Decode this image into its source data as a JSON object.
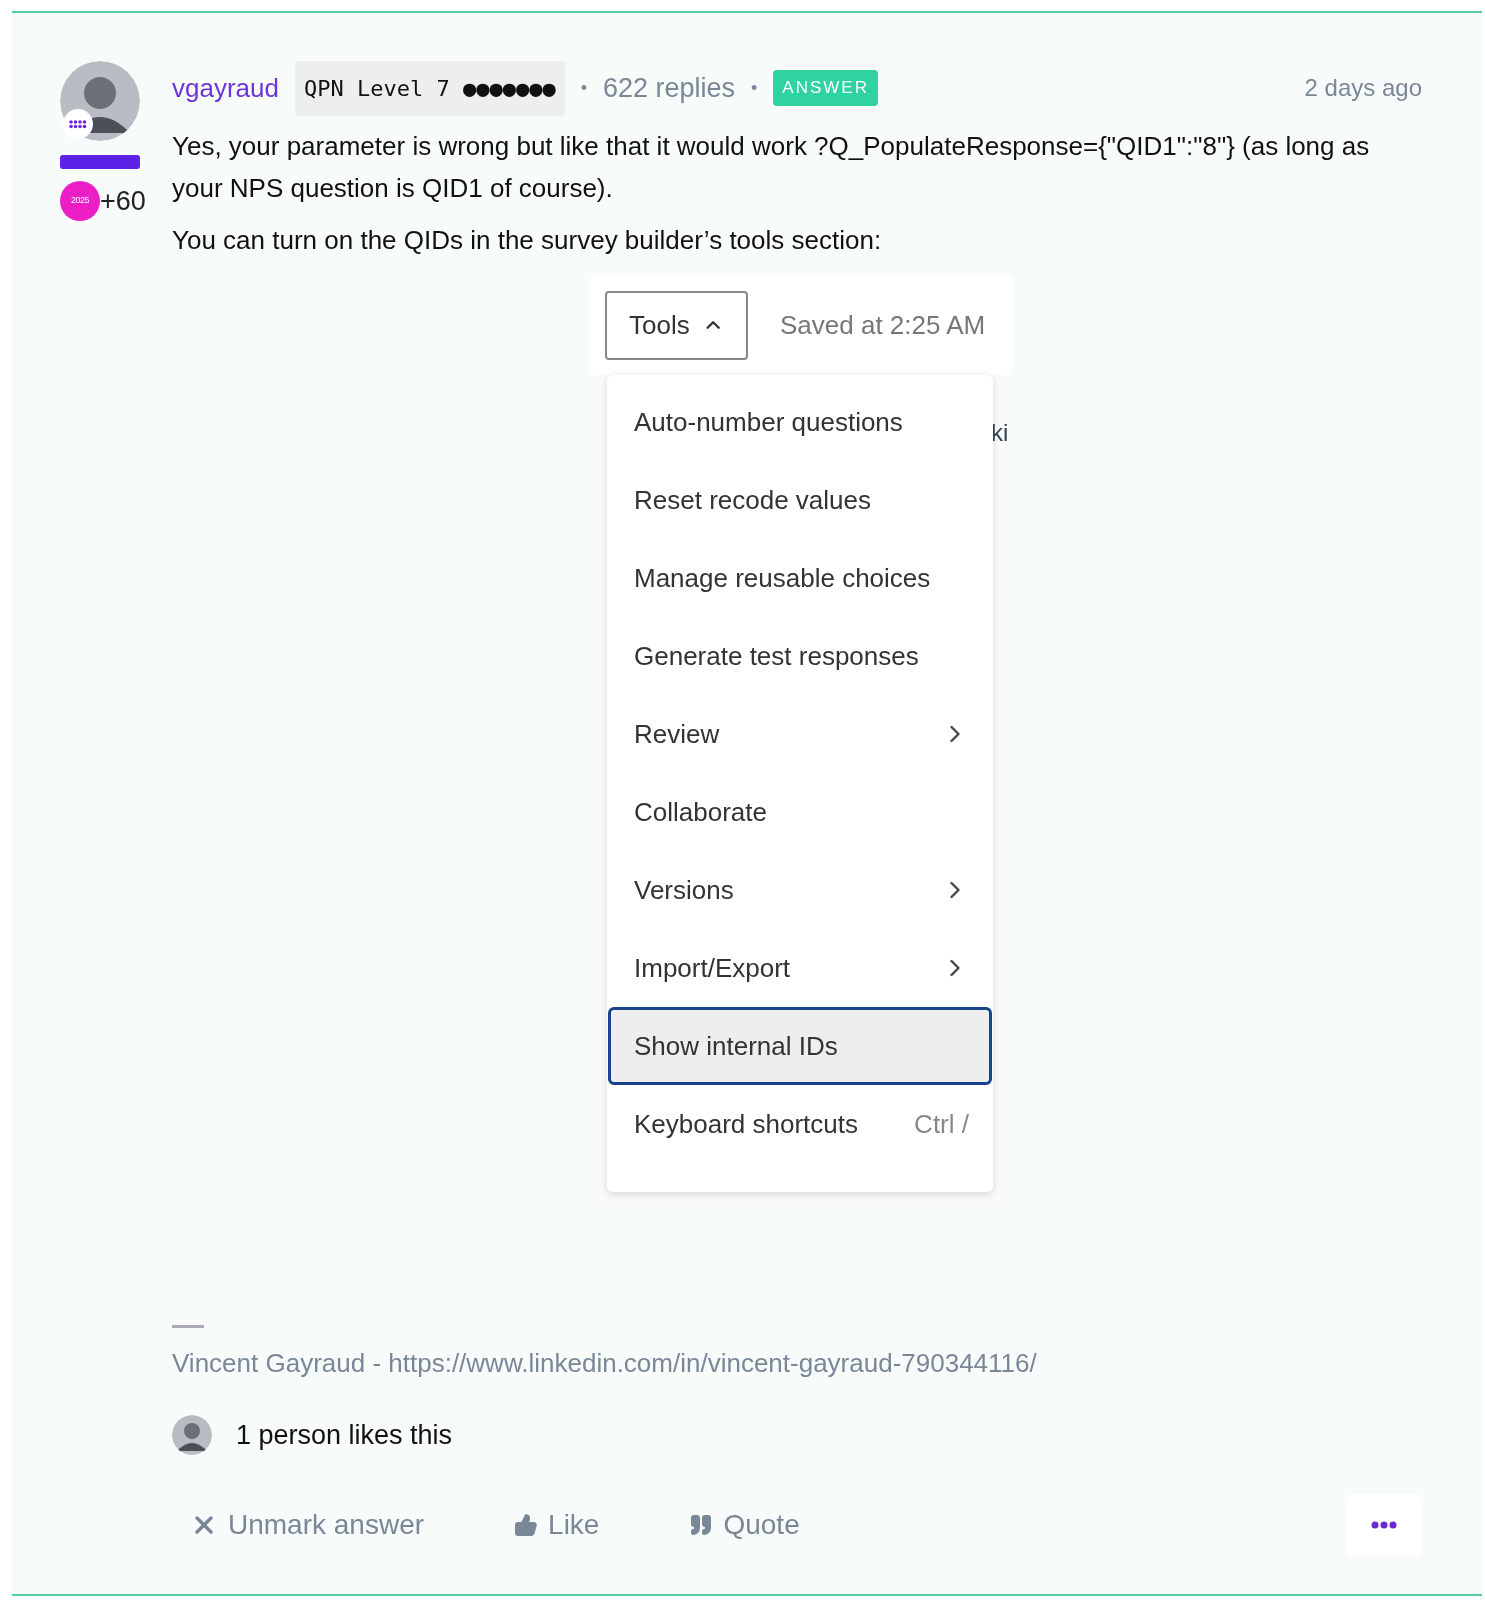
{
  "post": {
    "author": "vgayraud",
    "rank": "QPN Level 7 ●●●●●●●",
    "separator": "•",
    "replies": "622 replies",
    "answer_badge": "ANSWER",
    "time": "2 days ago",
    "badge_year": "2025",
    "badge_points": "+60",
    "paragraphs": [
      "Yes, your parameter is wrong but like that it would work ?Q_PopulateResponse={\"QID1\":\"8\"} (as long as your NPS question is QID1 of course).",
      "You can turn on the QIDs in the survey builder’s tools section:"
    ],
    "screenshot": {
      "tools_button": "Tools",
      "saved": "Saved at 2:25 AM",
      "behind_fragment": "ki",
      "menu": [
        {
          "label": "Auto-number questions",
          "kind": "plain",
          "selected": false
        },
        {
          "label": "Reset recode values",
          "kind": "plain",
          "selected": false
        },
        {
          "label": "Manage reusable choices",
          "kind": "plain",
          "selected": false
        },
        {
          "label": "Generate test responses",
          "kind": "plain",
          "selected": false
        },
        {
          "label": "Review",
          "kind": "submenu",
          "selected": false
        },
        {
          "label": "Collaborate",
          "kind": "plain",
          "selected": false
        },
        {
          "label": "Versions",
          "kind": "submenu",
          "selected": false
        },
        {
          "label": "Import/Export",
          "kind": "submenu",
          "selected": false
        },
        {
          "label": "Show internal IDs",
          "kind": "plain",
          "selected": true
        },
        {
          "label": "Keyboard shortcuts",
          "kind": "shortcut",
          "shortcut": "Ctrl /",
          "selected": false
        }
      ]
    },
    "signature": "Vincent Gayraud - https://www.linkedin.com/in/vincent-gayraud-790344116/",
    "likes": "1 person likes this",
    "actions": [
      {
        "label": "Unmark answer",
        "kind": "unmark"
      },
      {
        "label": "Like",
        "kind": "like"
      },
      {
        "label": "Quote",
        "kind": "quote"
      }
    ]
  }
}
